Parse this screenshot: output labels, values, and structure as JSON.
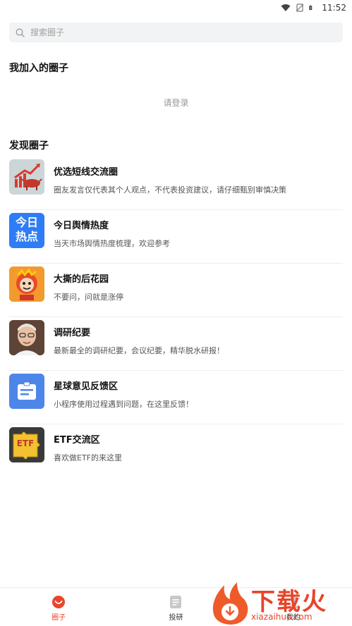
{
  "status_bar": {
    "time": "11:52"
  },
  "search": {
    "placeholder": "搜索圈子"
  },
  "my_circles": {
    "title": "我加入的圈子",
    "login_hint": "请登录"
  },
  "discover": {
    "title": "发现圈子",
    "items": [
      {
        "name": "优选短线交流圈",
        "desc": "圈友发言仅代表其个人观点，不代表投资建议，请仔细甄别审慎决策",
        "icon": "bull-icon"
      },
      {
        "name": "今日舆情热度",
        "desc": "当天市场舆情热度梳理，欢迎参考",
        "icon": "today-hot-icon",
        "icon_text": [
          "今日",
          "热点"
        ]
      },
      {
        "name": "大撕的后花园",
        "desc": "不要问，问就是涨停",
        "icon": "lion-dance-icon"
      },
      {
        "name": "调研纪要",
        "desc": "最新最全的调研纪要，会议纪要，精华脱水研报！",
        "icon": "portrait-icon"
      },
      {
        "name": "星球意见反馈区",
        "desc": "小程序使用过程遇到问题，在这里反馈！",
        "icon": "feedback-icon"
      },
      {
        "name": "ETF交流区",
        "desc": "喜欢做ETF的来这里",
        "icon": "etf-puzzle-icon",
        "icon_text": [
          "ETF"
        ]
      }
    ]
  },
  "bottom_nav": {
    "items": [
      {
        "label": "圈子",
        "active": true
      },
      {
        "label": "投研",
        "active": false
      },
      {
        "label": "我的",
        "active": false
      }
    ]
  },
  "watermark": {
    "text": "下载火",
    "url": "xiazaihuo.com"
  },
  "colors": {
    "accent": "#e8462c",
    "search_bg": "#f2f3f5",
    "feedback_blue": "#4d86e8",
    "today_blue": "#2e7cf6"
  }
}
